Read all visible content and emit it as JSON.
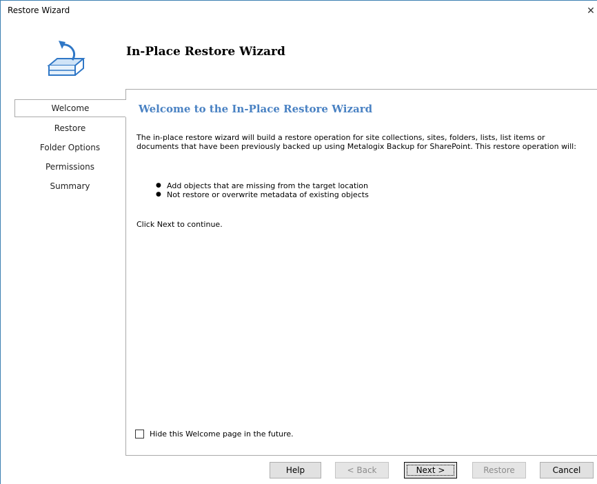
{
  "window": {
    "title": "Restore Wizard",
    "close_glyph": "✕"
  },
  "header": {
    "title": "In-Place Restore Wizard",
    "icon": "restore-database-icon"
  },
  "sidebar": {
    "items": [
      {
        "label": "Welcome",
        "active": true
      },
      {
        "label": "Restore",
        "active": false
      },
      {
        "label": "Folder Options",
        "active": false
      },
      {
        "label": "Permissions",
        "active": false
      },
      {
        "label": "Summary",
        "active": false
      }
    ]
  },
  "content": {
    "heading": "Welcome to the In-Place Restore Wizard",
    "intro": "The in-place restore wizard will build a restore operation for site collections, sites, folders, lists, list items or documents that have been previously backed up using Metalogix Backup for SharePoint. This restore operation will:",
    "bullets": [
      "Add objects that are missing from the target location",
      "Not restore or overwrite metadata of existing objects"
    ],
    "cta": "Click Next to continue.",
    "hide_checkbox_label": "Hide this Welcome page in the future.",
    "hide_checkbox_checked": false
  },
  "buttons": {
    "help": "Help",
    "back": "< Back",
    "next": "Next >",
    "restore": "Restore",
    "cancel": "Cancel"
  },
  "colors": {
    "heading": "#4a82c3",
    "window_border": "#3c7fb1",
    "icon_blue": "#2f77c6"
  }
}
